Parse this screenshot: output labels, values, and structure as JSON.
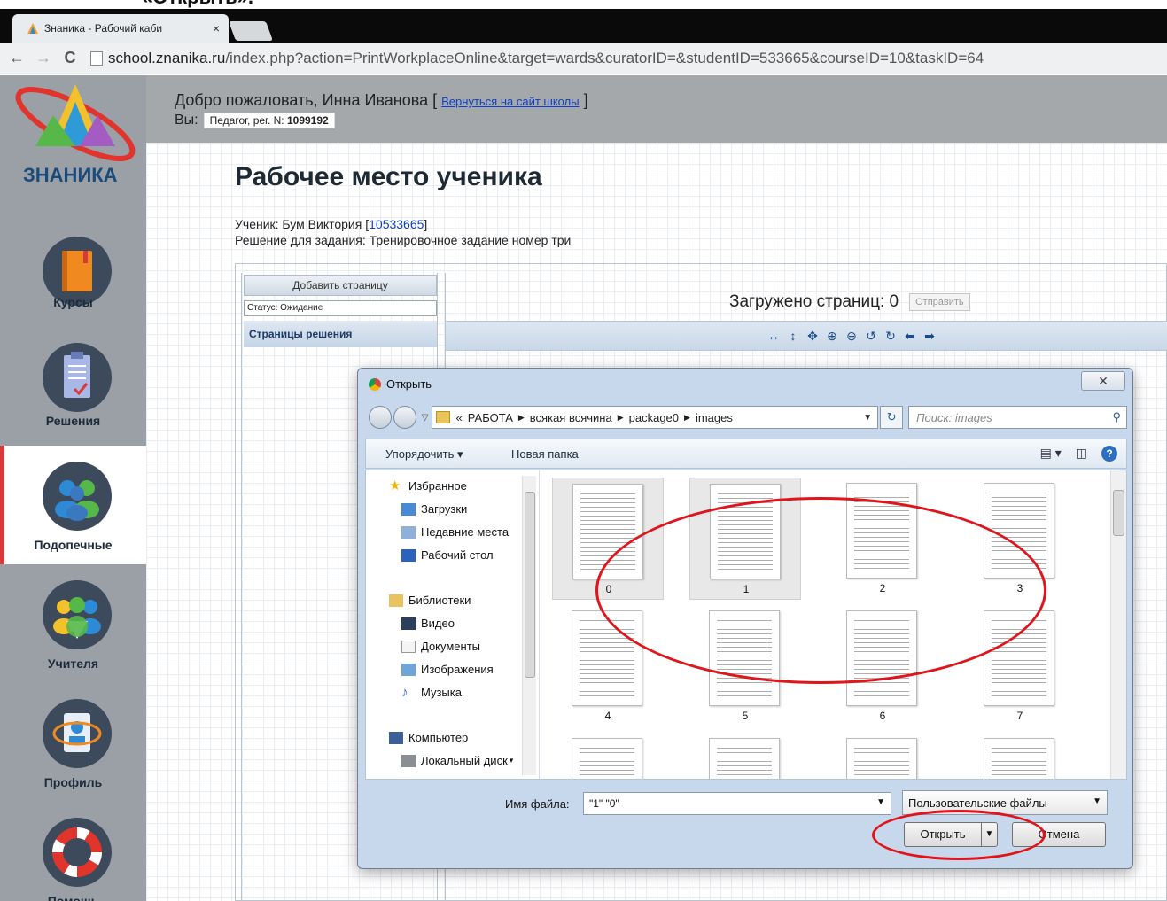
{
  "caption": "«Открыть».",
  "browser": {
    "tab_title": "Знаника - Рабочий каби",
    "tab_close": "×",
    "url_host": "school.znanika.ru",
    "url_path": "/index.php?action=PrintWorkplaceOnline&target=wards&curatorID=&studentID=533665&courseID=10&taskID=64",
    "back": "←",
    "forward": "→",
    "reload": "C"
  },
  "sidebar": {
    "logo": "ЗНАНИКА",
    "items": [
      {
        "label": "Курсы",
        "icon": "book-icon"
      },
      {
        "label": "Решения",
        "icon": "clipboard-icon"
      },
      {
        "label": "Подопечные",
        "icon": "students-icon",
        "active": true
      },
      {
        "label": "Учителя",
        "icon": "teachers-icon"
      },
      {
        "label": "Профиль",
        "icon": "profile-icon"
      },
      {
        "label": "Помощь",
        "icon": "lifebuoy-icon"
      }
    ]
  },
  "header": {
    "welcome": "Добро пожаловать, Инна Иванова [",
    "back_link": "Вернуться на сайт школы",
    "welcome_end": "]",
    "you_label": "Вы:",
    "role": "Педагог, рег. N:",
    "reg_number": "1099192"
  },
  "main": {
    "title": "Рабочее место ученика",
    "student_label": "Ученик: Бум Виктория [",
    "student_id": "10533665",
    "student_end": "]",
    "task": "Решение для задания: Тренировочное задание номер три",
    "add_page": "Добавить страницу",
    "status": "Статус: Ожидание",
    "pages_header": "Страницы решения",
    "loaded": "Загружено страниц: 0",
    "send": "Отправить"
  },
  "dialog": {
    "title": "Открыть",
    "close": "✕",
    "path": [
      "«",
      "РАБОТА",
      "всякая всячина",
      "package0",
      "images"
    ],
    "search_placeholder": "Поиск: images",
    "organize": "Упорядочить ▾",
    "new_folder": "Новая папка",
    "tree": [
      {
        "label": "Избранное",
        "icon": "star-icon"
      },
      {
        "label": "Загрузки",
        "icon": "downloads-icon"
      },
      {
        "label": "Недавние места",
        "icon": "recent-icon"
      },
      {
        "label": "Рабочий стол",
        "icon": "desktop-icon"
      },
      {
        "label": "Библиотеки",
        "icon": "libraries-icon"
      },
      {
        "label": "Видео",
        "icon": "video-icon"
      },
      {
        "label": "Документы",
        "icon": "documents-icon"
      },
      {
        "label": "Изображения",
        "icon": "images-icon"
      },
      {
        "label": "Музыка",
        "icon": "music-icon"
      },
      {
        "label": "Компьютер",
        "icon": "computer-icon"
      },
      {
        "label": "Локальный диск",
        "icon": "disk-icon"
      }
    ],
    "files": [
      "0",
      "1",
      "2",
      "3",
      "4",
      "5",
      "6",
      "7",
      "",
      "",
      "",
      ""
    ],
    "filename_label": "Имя файла:",
    "filename_value": "\"1\" \"0\"",
    "file_type": "Пользовательские файлы",
    "open_button": "Открыть",
    "cancel_button": "Отмена"
  },
  "colors": {
    "annotation": "#e0141b",
    "sidebar": "#9aa0a6",
    "header": "#a4a8ab",
    "accent_link": "#1040c0"
  }
}
